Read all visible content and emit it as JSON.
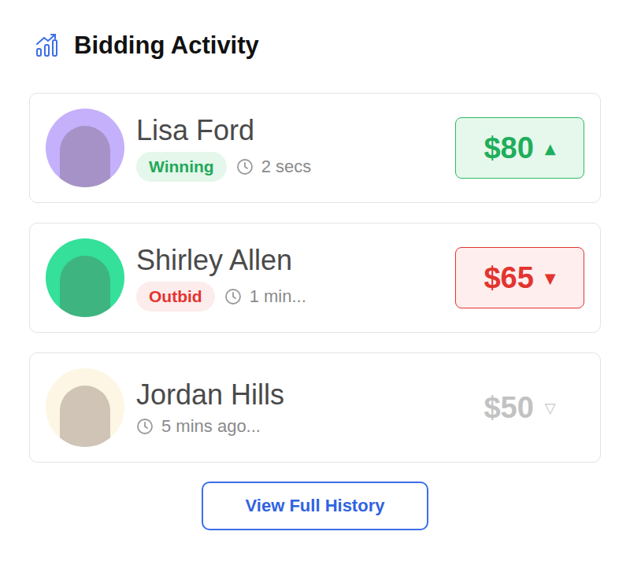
{
  "header": {
    "title": "Bidding Activity"
  },
  "bids": [
    {
      "name": "Lisa Ford",
      "state": "winning",
      "badge": "Winning",
      "time": "2 secs",
      "amount": "$80",
      "arrow": "▲",
      "color": "#c4b0fb"
    },
    {
      "name": "Shirley Allen",
      "state": "outbid",
      "badge": "Outbid",
      "time": "1 min...",
      "amount": "$65",
      "arrow": "▼",
      "color": "#34e09a"
    },
    {
      "name": "Jordan Hills",
      "state": "previous",
      "time": "5 mins ago...",
      "amount": "$50",
      "arrow": "▽",
      "color": "#fdf6e4"
    }
  ],
  "button": {
    "label": "View Full History"
  }
}
